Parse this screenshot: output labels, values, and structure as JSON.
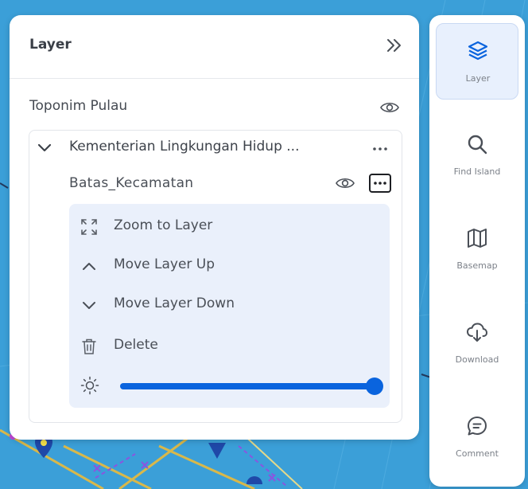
{
  "panel": {
    "title": "Layer",
    "collapse_icon": "double-chevron-right-icon"
  },
  "toponim": {
    "label": "Toponim Pulau",
    "visibility_icon": "eye-icon"
  },
  "group": {
    "title": "Kementerian Lingkungan Hidup ...",
    "menu_icon": "more-horizontal-icon",
    "sublayer": {
      "label": "Batas_Kecamatan",
      "visibility_icon": "eye-icon",
      "menu_icon": "more-horizontal-icon"
    }
  },
  "context_menu": {
    "items": [
      {
        "label": "Zoom to Layer",
        "icon": "zoom-extent-icon"
      },
      {
        "label": "Move Layer Up",
        "icon": "chevron-up-icon"
      },
      {
        "label": "Move Layer Down",
        "icon": "chevron-down-icon"
      },
      {
        "label": "Delete",
        "icon": "trash-icon"
      }
    ],
    "opacity": {
      "icon": "brightness-icon",
      "value": 1.0
    }
  },
  "toolbar": {
    "items": [
      {
        "label": "Layer",
        "icon": "layers-icon",
        "active": true
      },
      {
        "label": "Find Island",
        "icon": "search-icon",
        "active": false
      },
      {
        "label": "Basemap",
        "icon": "map-icon",
        "active": false
      },
      {
        "label": "Download",
        "icon": "cloud-download-icon",
        "active": false
      },
      {
        "label": "Comment",
        "icon": "comment-icon",
        "active": false
      }
    ]
  },
  "colors": {
    "accent": "#0a64de",
    "menu_background": "#eaf0fb",
    "text": "#4a4f57",
    "map_sea": "#3a9ed6"
  }
}
